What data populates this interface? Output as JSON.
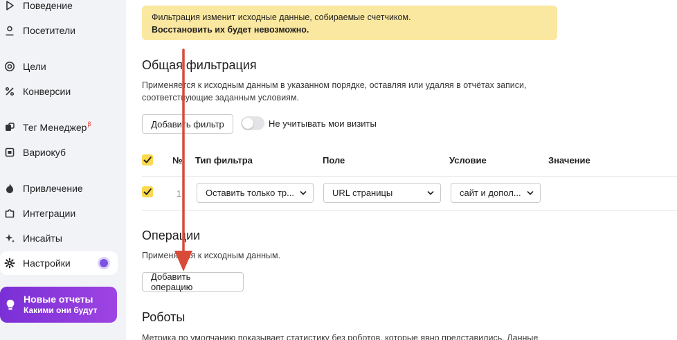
{
  "sidebar": {
    "items": [
      {
        "label": "Поведение",
        "icon": "play-icon"
      },
      {
        "label": "Посетители",
        "icon": "person-icon"
      },
      {
        "label": "Цели",
        "icon": "target-icon"
      },
      {
        "label": "Конверсии",
        "icon": "percent-icon"
      },
      {
        "label": "Тег Менеджер",
        "badge": "β",
        "icon": "tag-manager-icon"
      },
      {
        "label": "Вариокуб",
        "icon": "cube-icon"
      },
      {
        "label": "Привлечение",
        "icon": "flame-icon"
      },
      {
        "label": "Интеграции",
        "icon": "puzzle-icon"
      },
      {
        "label": "Инсайты",
        "icon": "sparkle-icon"
      },
      {
        "label": "Настройки",
        "icon": "gear-icon",
        "active": true
      }
    ],
    "promo": {
      "title": "Новые отчеты",
      "subtitle": "Какими они будут",
      "icon": "lightbulb-icon"
    }
  },
  "warning": {
    "line1": "Фильтрация изменит исходные данные, собираемые счетчиком.",
    "line2": "Восстановить их будет невозможно."
  },
  "filters": {
    "title": "Общая фильтрация",
    "description": "Применяется к исходным данным в указанном порядке, оставляя или удаляя в отчётах записи, соответствующие заданным условиям.",
    "add_button": "Добавить фильтр",
    "toggle_label": "Не учитывать мои визиты",
    "table": {
      "headers": {
        "num": "№",
        "type": "Тип фильтра",
        "field": "Поле",
        "condition": "Условие",
        "value": "Значение"
      },
      "rows": [
        {
          "num": "1",
          "type": "Оставить только тр...",
          "field": "URL страницы",
          "condition": "сайт и допол..."
        }
      ]
    }
  },
  "operations": {
    "title": "Операции",
    "description": "Применяется к исходным данным.",
    "add_button": "Добавить операцию"
  },
  "robots": {
    "title": "Роботы",
    "description": "Метрика по умолчанию показывает статистику без роботов, которые явно представились. Данные"
  },
  "colors": {
    "accent": "#fbd94c",
    "warning_bg": "#fbe8a0",
    "promo": "#8a3ddc",
    "arrow": "#d94a38",
    "notify_dot": "#7b55e0"
  }
}
